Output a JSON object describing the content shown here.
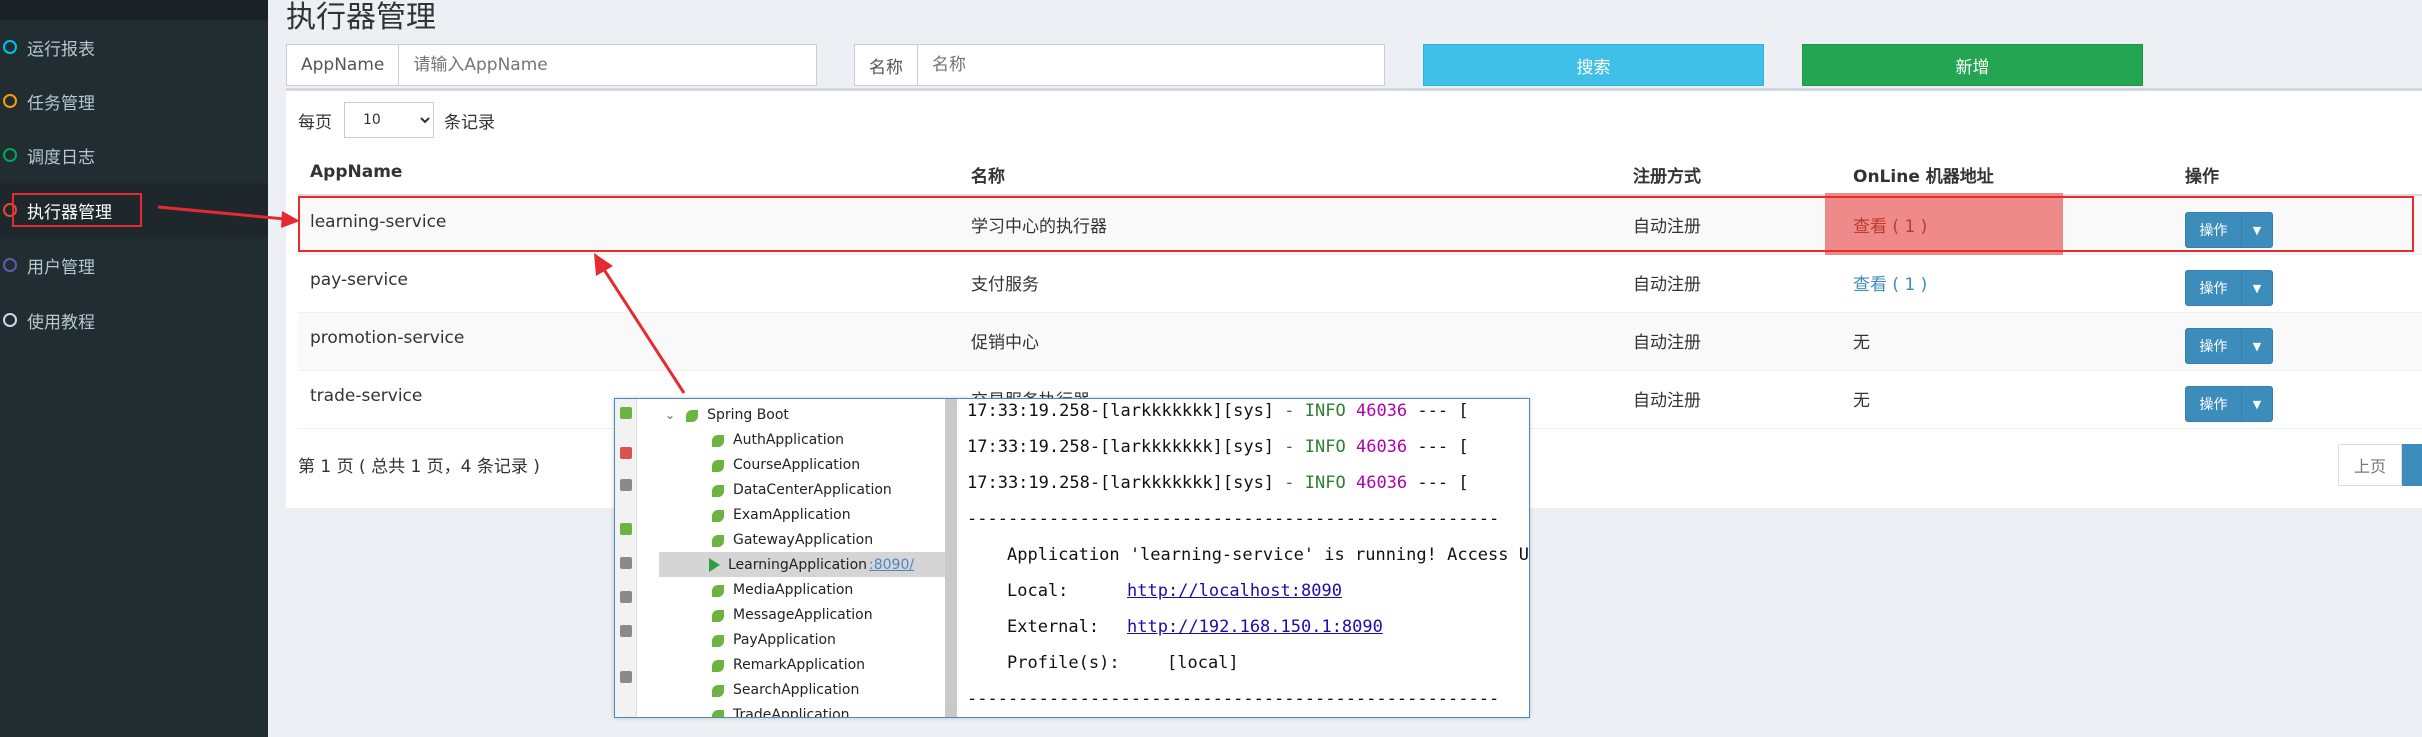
{
  "sidebar": {
    "items": [
      {
        "label": "运行报表",
        "color": "#00c0ef"
      },
      {
        "label": "任务管理",
        "color": "#f39c12"
      },
      {
        "label": "调度日志",
        "color": "#00a65a"
      },
      {
        "label": "执行器管理",
        "color": "#dd4b39"
      },
      {
        "label": "用户管理",
        "color": "#605ca8"
      },
      {
        "label": "使用教程",
        "color": "#d2d6de"
      }
    ]
  },
  "page": {
    "title": "执行器管理"
  },
  "search": {
    "appname_label": "AppName",
    "appname_placeholder": "请输入AppName",
    "name_label": "名称",
    "name_placeholder": "名称",
    "search_button": "搜索",
    "add_button": "新增"
  },
  "table": {
    "page_size_prefix": "每页",
    "page_size_value": "10",
    "page_size_suffix": "条记录",
    "headers": [
      "AppName",
      "名称",
      "注册方式",
      "OnLine 机器地址",
      "操作"
    ],
    "rows": [
      {
        "appname": "learning-service",
        "name": "学习中心的执行器",
        "reg": "自动注册",
        "online": "查看 ( 1 )",
        "op": "操作"
      },
      {
        "appname": "pay-service",
        "name": "支付服务",
        "reg": "自动注册",
        "online": "查看 ( 1 )",
        "op": "操作"
      },
      {
        "appname": "promotion-service",
        "name": "促销中心",
        "reg": "自动注册",
        "online": "无",
        "op": "操作"
      },
      {
        "appname": "trade-service",
        "name": "交易服务执行器",
        "reg": "自动注册",
        "online": "无",
        "op": "操作"
      }
    ],
    "page_info": "第 1 页 ( 总共 1 页，4 条记录 )",
    "prev_label": "上页"
  },
  "ide": {
    "tree_root": "Spring Boot",
    "apps": [
      "AuthApplication",
      "CourseApplication",
      "DataCenterApplication",
      "ExamApplication",
      "GatewayApplication",
      "LearningApplication",
      "MediaApplication",
      "MessageApplication",
      "PayApplication",
      "RemarkApplication",
      "SearchApplication",
      "TradeApplication"
    ],
    "running_port": ":8090/",
    "log_prefix": "17:33:19.258-[larkkkkkkk][sys]",
    "log_level": "- INFO",
    "log_pid": "46036",
    "log_tail": "--- [",
    "separator": "----------------------------------------------------",
    "running_msg": "Application 'learning-service' is running! Access UR",
    "local_label": "Local:",
    "local_url": "http://localhost:8090",
    "external_label": "External:",
    "external_url": "http://192.168.150.1:8090",
    "profile_label": "Profile(s):",
    "profile_value": "[local]"
  },
  "colors": {
    "accent": "#3c8dbc",
    "search": "#3ec0e8",
    "add": "#23a551",
    "annotation": "#e62a32",
    "highlight": "#ee8a8a"
  }
}
